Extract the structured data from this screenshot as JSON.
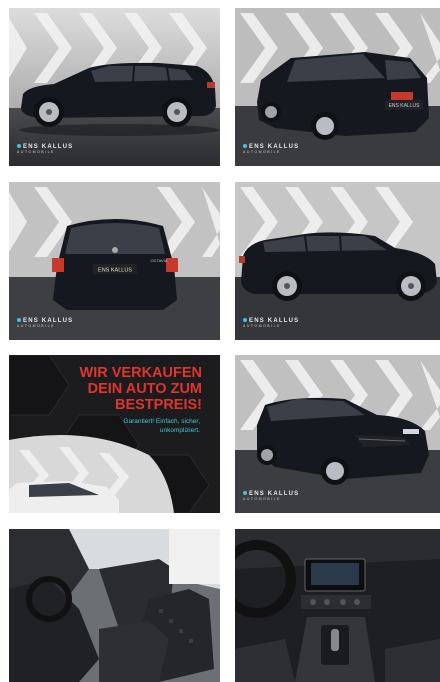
{
  "gallery": {
    "watermark_brand": "ENS KALLUS",
    "watermark_sub": "AUTOMOBILE",
    "promo": {
      "line1": "WIR VERKAUFEN",
      "line2": "DEIN AUTO ZUM",
      "line3": "BESTPREIS!",
      "sub1": "Garantiert! Einfach, sicher,",
      "sub2": "unkompliziert."
    },
    "plate_text": "ENS KALLUS",
    "badge_text": "OCTAVIA"
  },
  "colors": {
    "promo_red": "#e0342e",
    "promo_cyan": "#3ec6d8",
    "car_body": "#15181f"
  }
}
